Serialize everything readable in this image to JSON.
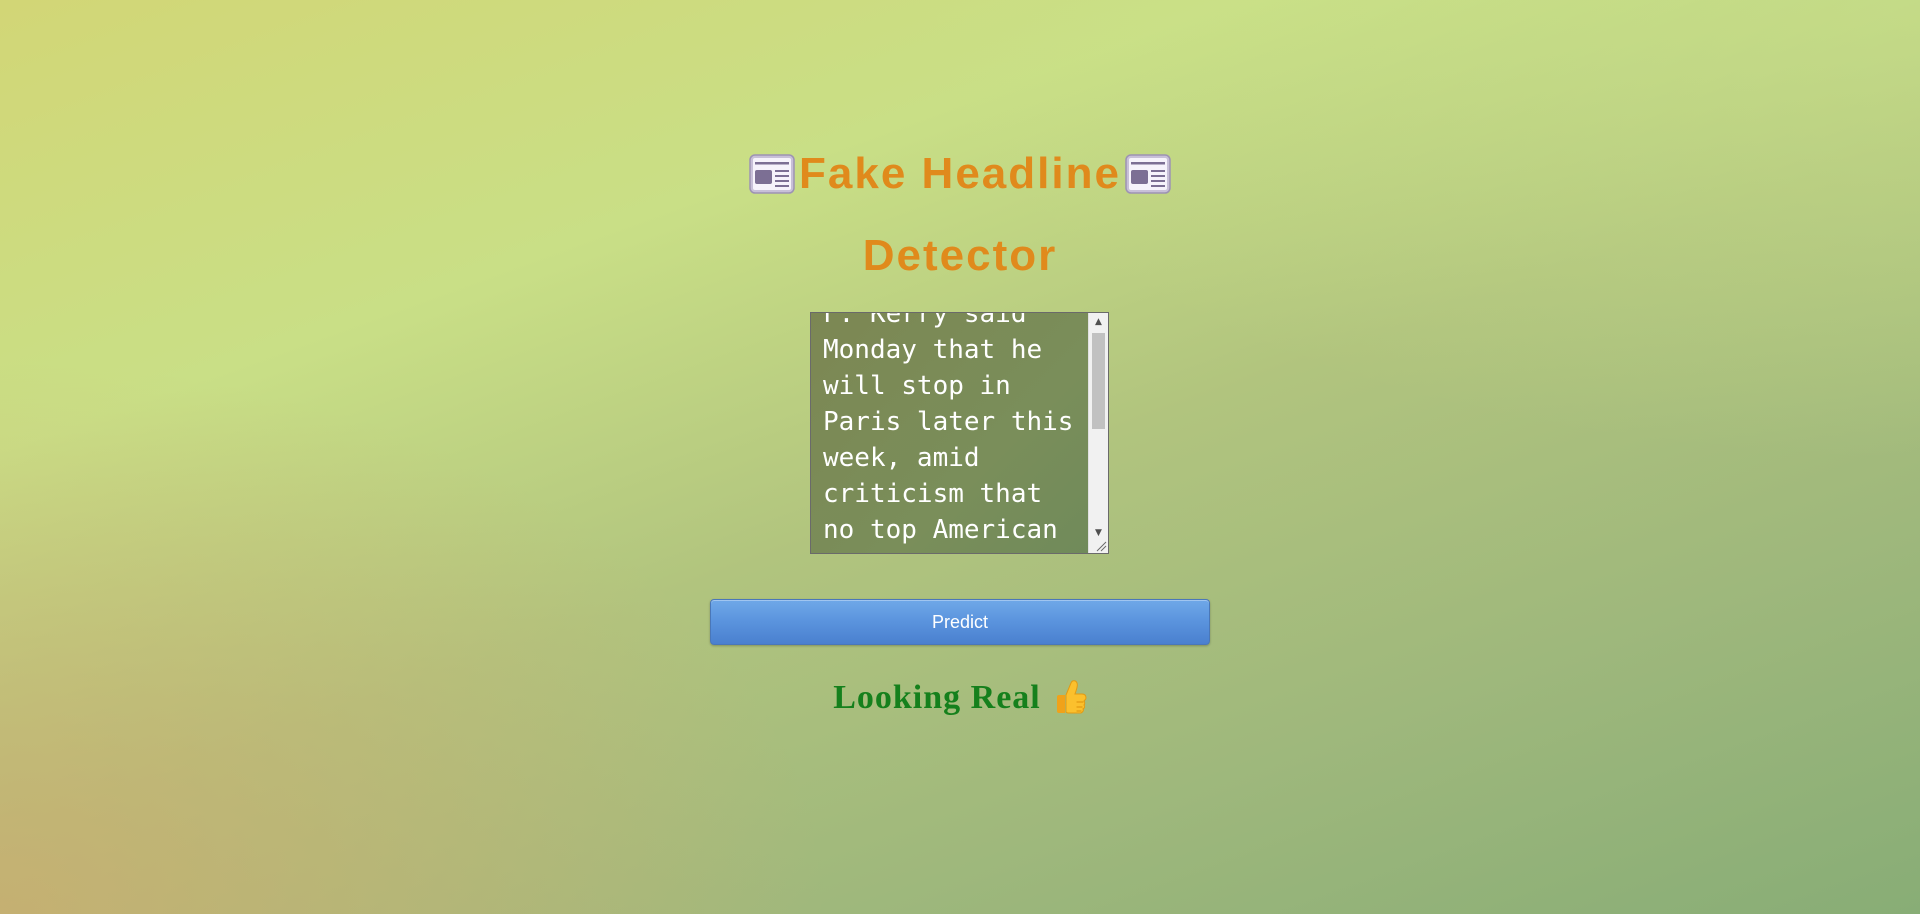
{
  "page": {
    "title_line1": "Fake Headline",
    "title_line2": "Detector",
    "title_icon": "newspaper-icon",
    "title_color": "#e08a1c"
  },
  "input": {
    "value": "F. Kerry said Monday that he will stop in Paris later this week, amid criticism that no top American official attended Sunday's unity march against terrorism.",
    "scroll_position": 0.15
  },
  "predict_button": {
    "label": "Predict",
    "color": "#5a93dd"
  },
  "result": {
    "text": "Looking Real",
    "icon": "thumbs-up-icon",
    "color": "#15801c"
  }
}
